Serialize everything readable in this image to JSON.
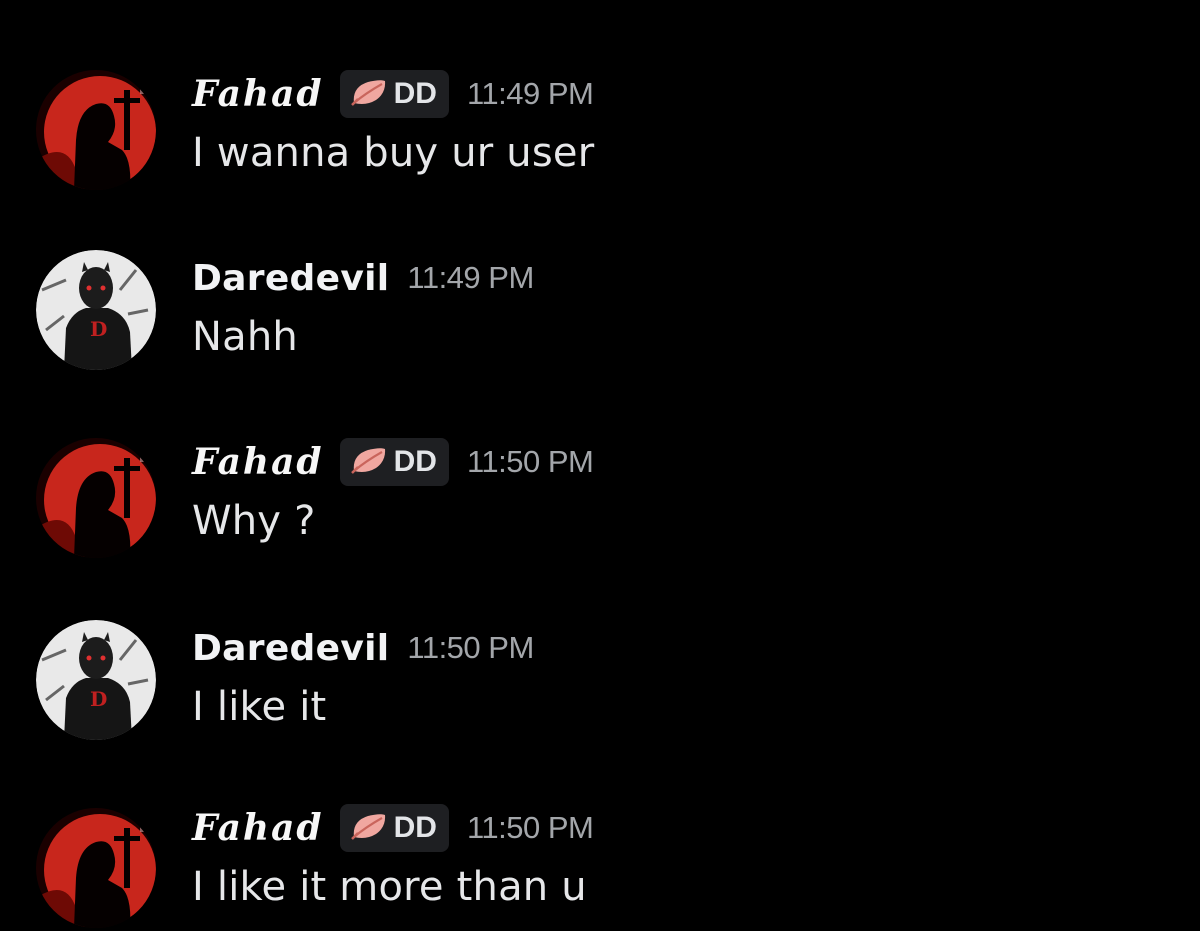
{
  "messages": [
    {
      "username": "Fahad",
      "tag": "DD",
      "time": "11:49 PM",
      "text": "I wanna buy ur user",
      "avatar": "red-silhouette-avatar",
      "tag_icon": "leaf-icon"
    },
    {
      "username": "Daredevil",
      "tag": "",
      "time": "11:49 PM",
      "text": "Nahh",
      "avatar": "daredevil-avatar"
    },
    {
      "username": "Fahad",
      "tag": "DD",
      "time": "11:50 PM",
      "text": "Why ?",
      "avatar": "red-silhouette-avatar",
      "tag_icon": "leaf-icon"
    },
    {
      "username": "Daredevil",
      "tag": "",
      "time": "11:50 PM",
      "text": "I like it",
      "avatar": "daredevil-avatar"
    },
    {
      "username": "Fahad",
      "tag": "DD",
      "time": "11:50 PM",
      "text": "I like it more than u",
      "avatar": "red-silhouette-avatar",
      "tag_icon": "leaf-icon"
    }
  ],
  "colors": {
    "background": "#000000",
    "tag_background": "#1e1f22",
    "timestamp": "#a3a6aa",
    "leaf_icon": "#f0a7a0",
    "avatar_red": "#c8261c"
  }
}
